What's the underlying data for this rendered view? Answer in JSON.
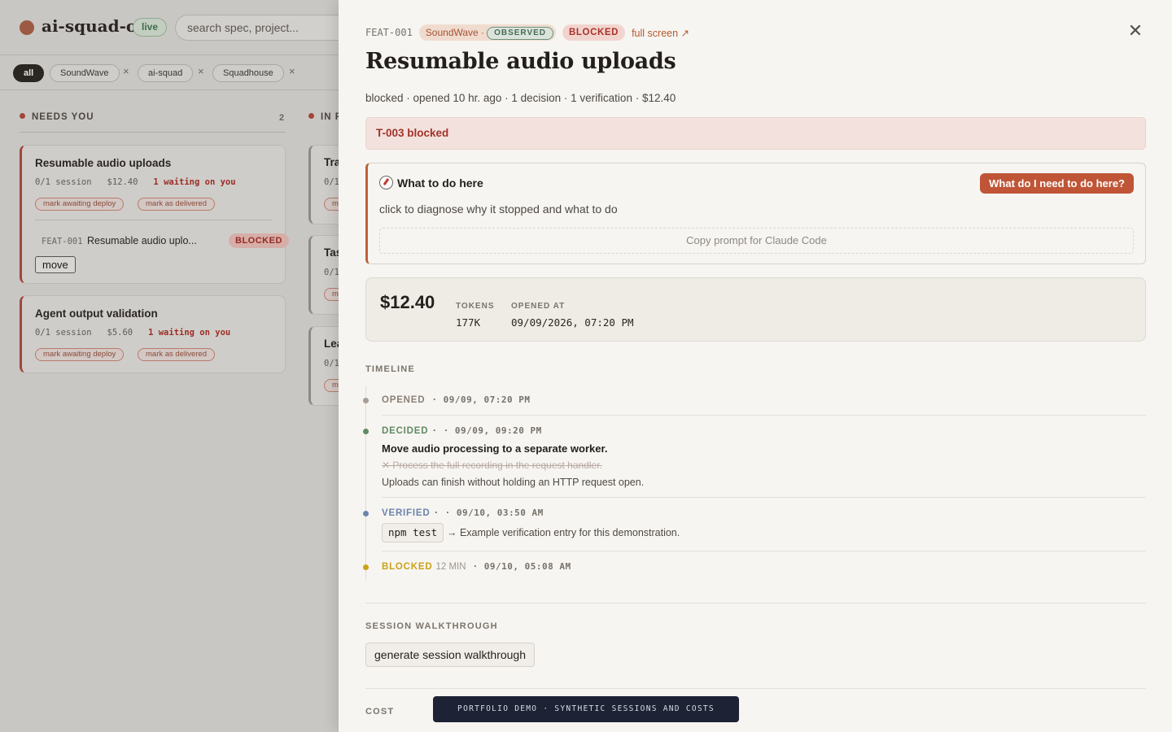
{
  "app": {
    "title": "ai-squad-os",
    "live_badge": "live",
    "search_placeholder": "search spec, project...",
    "accent": "#bf5536"
  },
  "filters": {
    "chips": [
      "all",
      "SoundWave",
      "ai-squad",
      "Squadhouse"
    ],
    "remove_glyph": "×"
  },
  "columns": {
    "needs_you": {
      "title": "NEEDS YOU",
      "count": "2",
      "cards": [
        {
          "title": "Resumable audio uploads",
          "sessions": "0/1 session",
          "cost": "$12.40",
          "waiting": "1 waiting on you",
          "action_deploy": "mark awaiting deploy",
          "action_delivered": "mark as delivered",
          "sub_id": "FEAT-001",
          "sub_title": "Resumable audio uplo...",
          "sub_status": "BLOCKED",
          "move_label": "move"
        },
        {
          "title": "Agent output validation",
          "sessions": "0/1 session",
          "cost": "$5.60",
          "waiting": "1 waiting on you",
          "action_deploy": "mark awaiting deploy",
          "action_delivered": "mark as delivered"
        }
      ]
    },
    "in_progress": {
      "title_partial": "IN P",
      "cards": [
        {
          "title_partial": "Tra",
          "meta_partial": "0/1",
          "btn_partial": "m"
        },
        {
          "title_partial": "Tas",
          "meta_partial": "0/1",
          "btn_partial": "m"
        },
        {
          "title_partial": "Lea",
          "meta_partial": "0/1",
          "btn_partial": "m"
        }
      ]
    }
  },
  "drawer": {
    "feature_id": "FEAT-001",
    "project": "SoundWave ·",
    "observed": "OBSERVED",
    "status": "BLOCKED",
    "full_screen": "full screen ↗",
    "close_glyph": "✕",
    "title": "Resumable audio uploads",
    "subtitle": "blocked · opened 10 hr. ago · 1 decision · 1 verification · $12.40",
    "alert": "T-003 blocked",
    "todo": {
      "title": "What to do here",
      "button": "What do I need to do here?",
      "description": "click to diagnose why it stopped and what to do",
      "copy_prompt": "Copy prompt for Claude Code"
    },
    "stats": {
      "cost": "$12.40",
      "tokens_label": "TOKENS",
      "tokens_value": "177K",
      "opened_label": "OPENED AT",
      "opened_value": "09/09/2026, 07:20 PM"
    },
    "timeline": {
      "label": "TIMELINE",
      "events": [
        {
          "type": "OPENED",
          "time": "· 09/09, 07:20 PM",
          "color": "#a89d94"
        },
        {
          "type": "DECIDED",
          "time": "· · 09/09, 09:20 PM",
          "color": "#5f8a64",
          "decision": "Move audio processing to a separate worker.",
          "rejected": "✕ Process the full recording in the request handler.",
          "reason": "Uploads can finish without holding an HTTP request open."
        },
        {
          "type": "VERIFIED",
          "time": "· · 09/10, 03:50 AM",
          "color": "#6b84ad",
          "command": "npm test",
          "note": "→ Example verification entry for this demonstration."
        },
        {
          "type": "BLOCKED",
          "duration": "12 MIN",
          "time": "· 09/10, 05:08 AM",
          "color": "#c9a21a"
        }
      ]
    },
    "walkthrough": {
      "label": "SESSION WALKTHROUGH",
      "button": "generate session walkthrough"
    },
    "cost_label": "COST",
    "demo_banner": "PORTFOLIO DEMO · SYNTHETIC SESSIONS AND COSTS"
  }
}
